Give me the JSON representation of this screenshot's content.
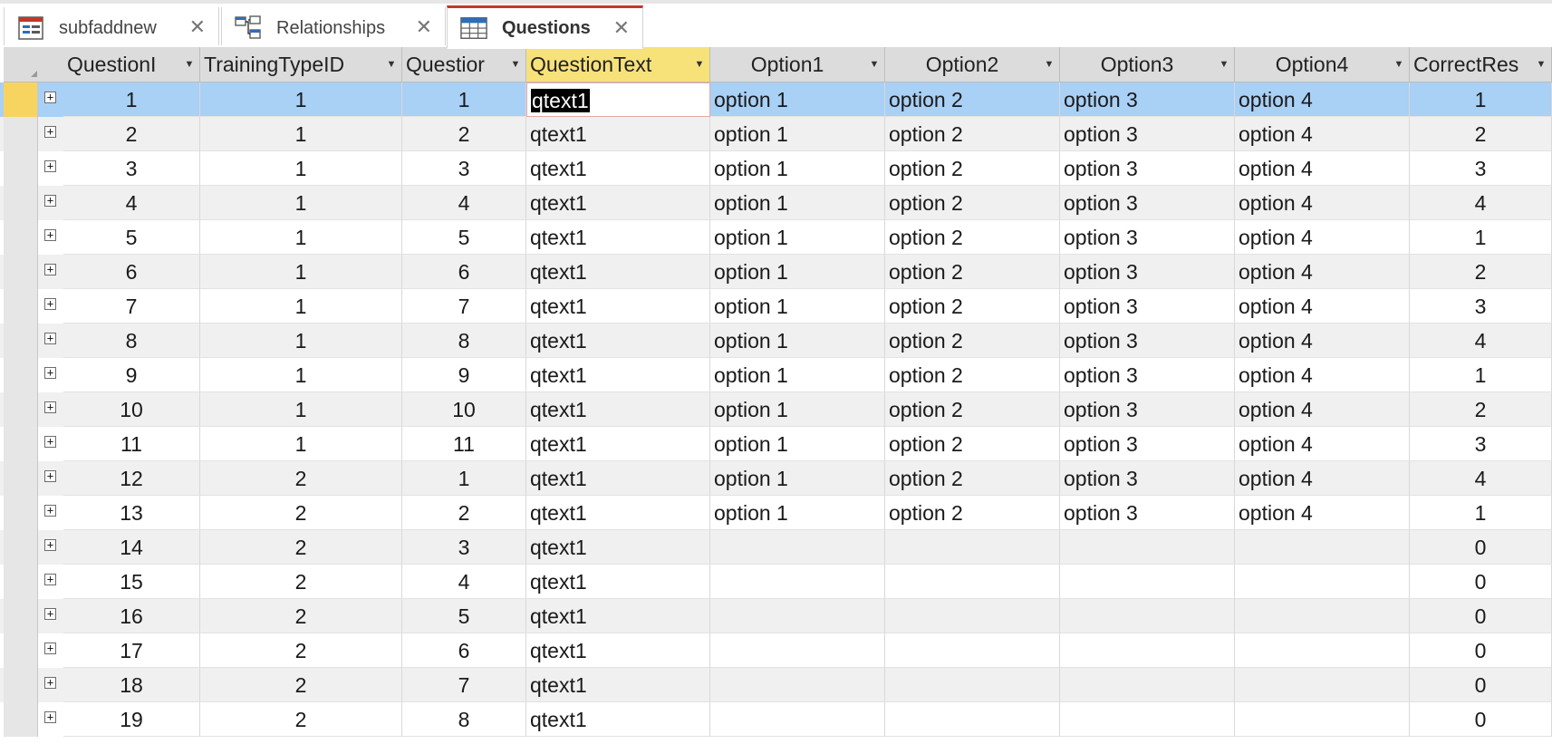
{
  "tabs": [
    {
      "label": "subfaddnew",
      "icon": "form-icon",
      "active": false
    },
    {
      "label": "Relationships",
      "icon": "relationships-icon",
      "active": false
    },
    {
      "label": "Questions",
      "icon": "table-icon",
      "active": true
    }
  ],
  "columns": [
    "QuestionI",
    "TrainingTypeID",
    "Questior",
    "QuestionText",
    "Option1",
    "Option2",
    "Option3",
    "Option4",
    "CorrectRes"
  ],
  "selected_column": "QuestionText",
  "rows": [
    [
      "1",
      "1",
      "1",
      "qtext1",
      "option 1",
      "option 2",
      "option 3",
      "option 4",
      "1"
    ],
    [
      "2",
      "1",
      "2",
      "qtext1",
      "option 1",
      "option 2",
      "option 3",
      "option 4",
      "2"
    ],
    [
      "3",
      "1",
      "3",
      "qtext1",
      "option 1",
      "option 2",
      "option 3",
      "option 4",
      "3"
    ],
    [
      "4",
      "1",
      "4",
      "qtext1",
      "option 1",
      "option 2",
      "option 3",
      "option 4",
      "4"
    ],
    [
      "5",
      "1",
      "5",
      "qtext1",
      "option 1",
      "option 2",
      "option 3",
      "option 4",
      "1"
    ],
    [
      "6",
      "1",
      "6",
      "qtext1",
      "option 1",
      "option 2",
      "option 3",
      "option 4",
      "2"
    ],
    [
      "7",
      "1",
      "7",
      "qtext1",
      "option 1",
      "option 2",
      "option 3",
      "option 4",
      "3"
    ],
    [
      "8",
      "1",
      "8",
      "qtext1",
      "option 1",
      "option 2",
      "option 3",
      "option 4",
      "4"
    ],
    [
      "9",
      "1",
      "9",
      "qtext1",
      "option 1",
      "option 2",
      "option 3",
      "option 4",
      "1"
    ],
    [
      "10",
      "1",
      "10",
      "qtext1",
      "option 1",
      "option 2",
      "option 3",
      "option 4",
      "2"
    ],
    [
      "11",
      "1",
      "11",
      "qtext1",
      "option 1",
      "option 2",
      "option 3",
      "option 4",
      "3"
    ],
    [
      "12",
      "2",
      "1",
      "qtext1",
      "option 1",
      "option 2",
      "option 3",
      "option 4",
      "4"
    ],
    [
      "13",
      "2",
      "2",
      "qtext1",
      "option 1",
      "option 2",
      "option 3",
      "option 4",
      "1"
    ],
    [
      "14",
      "2",
      "3",
      "qtext1",
      "",
      "",
      "",
      "",
      "0"
    ],
    [
      "15",
      "2",
      "4",
      "qtext1",
      "",
      "",
      "",
      "",
      "0"
    ],
    [
      "16",
      "2",
      "5",
      "qtext1",
      "",
      "",
      "",
      "",
      "0"
    ],
    [
      "17",
      "2",
      "6",
      "qtext1",
      "",
      "",
      "",
      "",
      "0"
    ],
    [
      "18",
      "2",
      "7",
      "qtext1",
      "",
      "",
      "",
      "",
      "0"
    ],
    [
      "19",
      "2",
      "8",
      "qtext1",
      "",
      "",
      "",
      "",
      "0"
    ]
  ],
  "current_row_index": 0,
  "colors": {
    "accent": "#c0392b",
    "selected_header": "#f7e27a",
    "current_row": "#a9d0f5"
  }
}
